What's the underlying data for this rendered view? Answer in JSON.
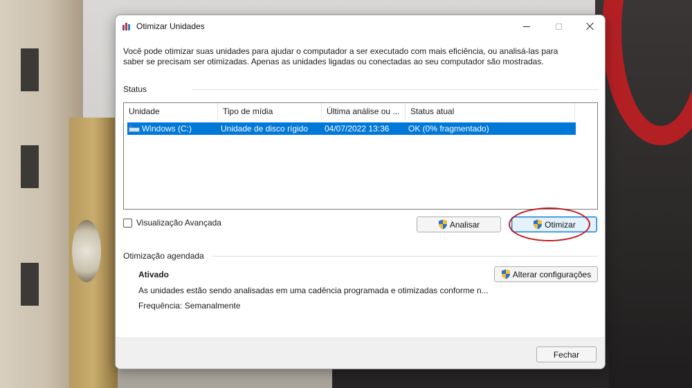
{
  "window": {
    "title": "Otimizar Unidades",
    "description": "Você pode otimizar suas unidades para ajudar o computador a ser executado com mais eficiência, ou analisá-las para saber se precisam ser otimizadas. Apenas as unidades ligadas ou conectadas ao seu computador são mostradas."
  },
  "status": {
    "label": "Status",
    "columns": [
      "Unidade",
      "Tipo de mídia",
      "Última análise ou ...",
      "Status atual"
    ],
    "rows": [
      {
        "drive": "Windows (C:)",
        "media_type": "Unidade de disco rígido",
        "last_analysis": "04/07/2022 13:36",
        "current_status": "OK (0% fragmentado)",
        "selected": true
      }
    ]
  },
  "advanced_view": {
    "label": "Visualização Avançada",
    "checked": false
  },
  "buttons": {
    "analyze": "Analisar",
    "optimize": "Otimizar",
    "change_settings": "Alterar configurações",
    "close": "Fechar"
  },
  "scheduled": {
    "label": "Otimização agendada",
    "state": "Ativado",
    "description": "As unidades estão sendo analisadas em uma cadência programada e otimizadas conforme n...",
    "frequency": "Frequência: Semanalmente"
  },
  "colors": {
    "selection": "#0078d7",
    "annotation": "#c0181f"
  },
  "icons": {
    "app": "defrag-icon",
    "drive": "hard-drive-icon",
    "shield": "uac-shield-icon"
  }
}
